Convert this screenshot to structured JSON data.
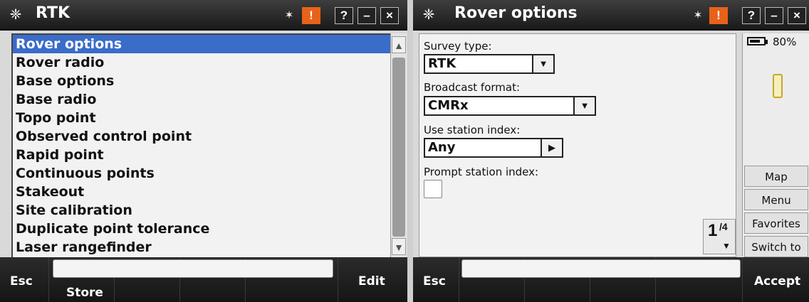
{
  "left": {
    "title": "RTK",
    "list_items": [
      "Rover options",
      "Rover radio",
      "Base options",
      "Base radio",
      "Topo point",
      "Observed control point",
      "Rapid point",
      "Continuous points",
      "Stakeout",
      "Site calibration",
      "Duplicate point tolerance",
      "Laser rangefinder"
    ],
    "softkeys": {
      "esc": "Esc",
      "store": "Store",
      "edit": "Edit"
    }
  },
  "right": {
    "title": "Rover options",
    "fields": {
      "survey_type_label": "Survey type:",
      "survey_type_value": "RTK",
      "broadcast_label": "Broadcast format:",
      "broadcast_value": "CMRx",
      "station_index_label": "Use station index:",
      "station_index_value": "Any",
      "prompt_label": "Prompt station index:"
    },
    "pager": {
      "current": "1",
      "total": "/4"
    },
    "status": {
      "battery": "80%"
    },
    "side_buttons": [
      "Map",
      "Menu",
      "Favorites",
      "Switch to"
    ],
    "softkeys": {
      "esc": "Esc",
      "accept": "Accept"
    }
  },
  "titlebar_buttons": {
    "warn": "!",
    "help": "?",
    "min": "–",
    "close": "×"
  },
  "icons": {
    "app": "trimble-logo-icon",
    "satellite": "satellite-icon"
  },
  "colors": {
    "selection": "#3a6cc9",
    "warning": "#e8621a",
    "titlebar": "#1a1a1a"
  }
}
